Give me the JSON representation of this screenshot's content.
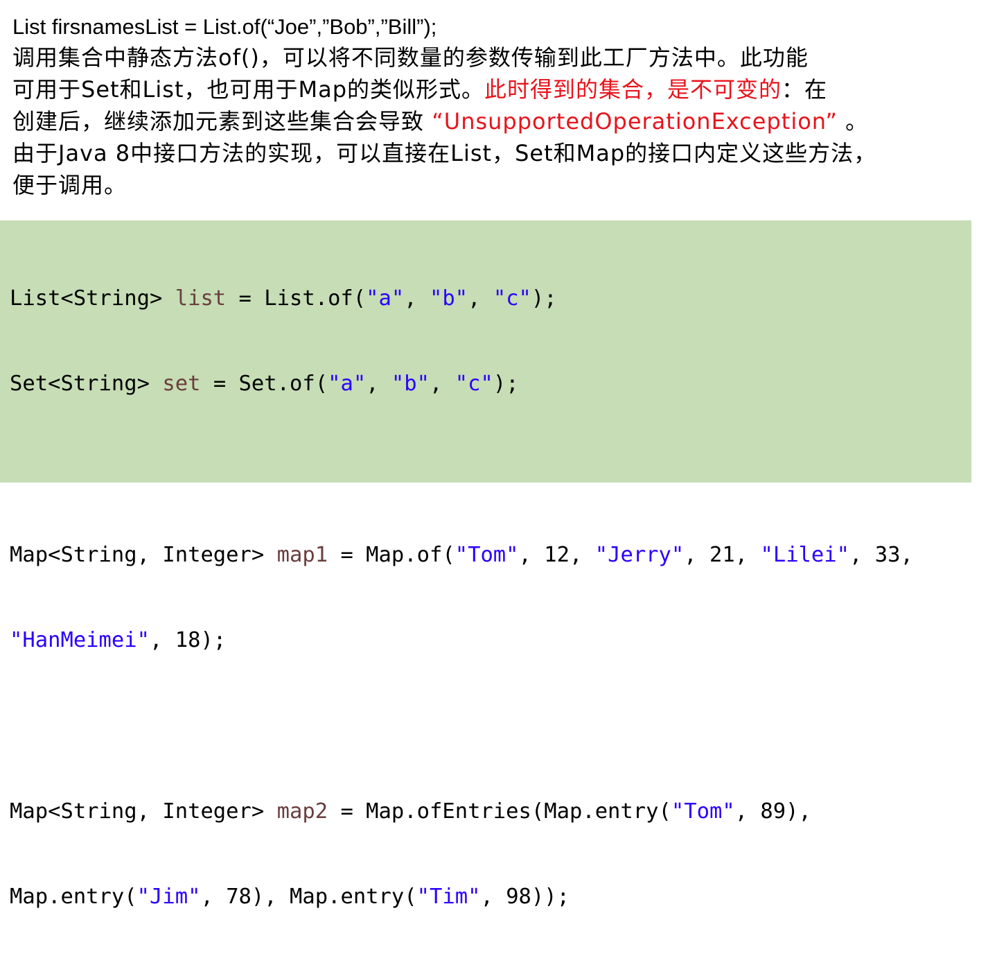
{
  "description": {
    "title_code": "List firsnamesList = List.of(“Joe”,”Bob”,”Bill”);",
    "line1": "调用集合中静态方法of()，可以将不同数量的参数传输到此工厂方法中。此功能",
    "line2_prefix": "可用于Set和List，也可用于Map的类似形式。",
    "line2_red": "此时得到的集合，是不可变的",
    "line2_suffix": "：在",
    "line3_prefix": "创建后，继续添加元素到这些集合会导致 ",
    "line3_red": "“UnsupportedOperationException”",
    "line3_suffix": " 。",
    "line4": "由于Java 8中接口方法的实现，可以直接在List，Set和Map的接口内定义这些方法，",
    "line5": "便于调用。"
  },
  "code": {
    "l1": {
      "type": "List<String> ",
      "var": "list",
      "mid": " = List.of(",
      "s1": "\"a\"",
      "c1": ", ",
      "s2": "\"b\"",
      "c2": ", ",
      "s3": "\"c\"",
      "end": ");"
    },
    "l2": {
      "type": "Set<String> ",
      "var": "set",
      "mid": " = Set.of(",
      "s1": "\"a\"",
      "c1": ", ",
      "s2": "\"b\"",
      "c2": ", ",
      "s3": "\"c\"",
      "end": ");"
    },
    "l3": {
      "type": "Map<String, Integer> ",
      "var": "map1",
      "mid": " = Map.of(",
      "s1": "\"Tom\"",
      "n1": ", 12, ",
      "s2": "\"Jerry\"",
      "n2": ", 21, ",
      "s3": "\"Lilei\"",
      "n3": ", 33,"
    },
    "l4": {
      "s1": "\"HanMeimei\"",
      "end": ", 18);"
    },
    "l5": {
      "type": "Map<String, Integer> ",
      "var": "map2",
      "mid": " = Map.ofEntries(Map.entry(",
      "s1": "\"Tom\"",
      "end": ", 89),"
    },
    "l6": {
      "a": "Map.entry(",
      "s1": "\"Jim\"",
      "b": ", 78), Map.entry(",
      "s2": "\"Tim\"",
      "end": ", 98));"
    }
  },
  "colors": {
    "accent_red": "#e8131b",
    "code_background": "#c6ddb5",
    "code_variable": "#6a3e3e",
    "code_string": "#2a00ff"
  }
}
